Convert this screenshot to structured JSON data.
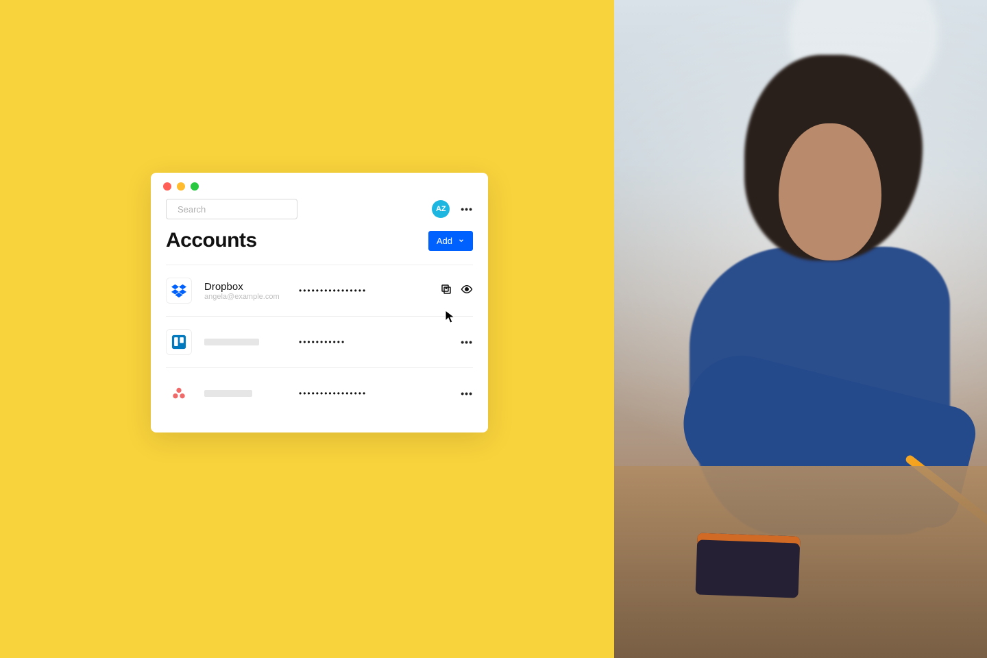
{
  "window": {
    "title": "Accounts"
  },
  "search": {
    "placeholder": "Search"
  },
  "avatar": {
    "initials": "AZ"
  },
  "add_button": {
    "label": "Add"
  },
  "accounts": [
    {
      "icon": "dropbox",
      "name": "Dropbox",
      "subtitle": "angela@example.com",
      "password_mask": "••••••••••••••••",
      "active": true
    },
    {
      "icon": "trello",
      "name": "",
      "subtitle": "",
      "password_mask": "•••••••••••",
      "active": false
    },
    {
      "icon": "asana",
      "name": "",
      "subtitle": "",
      "password_mask": "••••••••••••••••",
      "active": false
    }
  ]
}
